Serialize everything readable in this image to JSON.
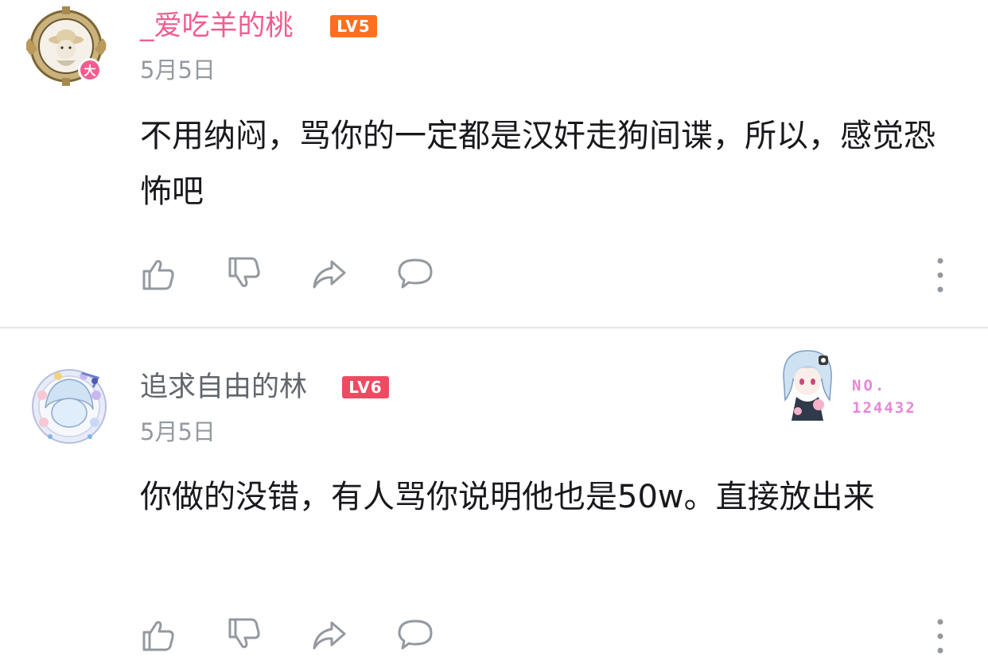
{
  "colors": {
    "username_vip": "#f25d8e",
    "username_normal": "#61666d",
    "level5": "#ff6f1f",
    "level6": "#ee4b62",
    "meta_gray": "#9499a0",
    "icon_gray": "#9499a0",
    "badge_pink": "#e687d6"
  },
  "comments": [
    {
      "username": "_爱吃羊的桃",
      "level": "LV5",
      "date": "5月5日",
      "avatar_badge": "大",
      "content": "不用纳闷，骂你的一定都是汉奸走狗间谍，所以，感觉恐怖吧",
      "actions": [
        "like-icon",
        "dislike-icon",
        "share-icon",
        "reply-icon",
        "more-icon"
      ]
    },
    {
      "username": "追求自由的林",
      "level": "LV6",
      "date": "5月5日",
      "content": "你做的没错，有人骂你说明他也是50w。直接放出来",
      "fan_badge": {
        "label": "NO.",
        "number": "124432"
      },
      "actions": [
        "like-icon",
        "dislike-icon",
        "share-icon",
        "reply-icon",
        "more-icon"
      ]
    }
  ]
}
